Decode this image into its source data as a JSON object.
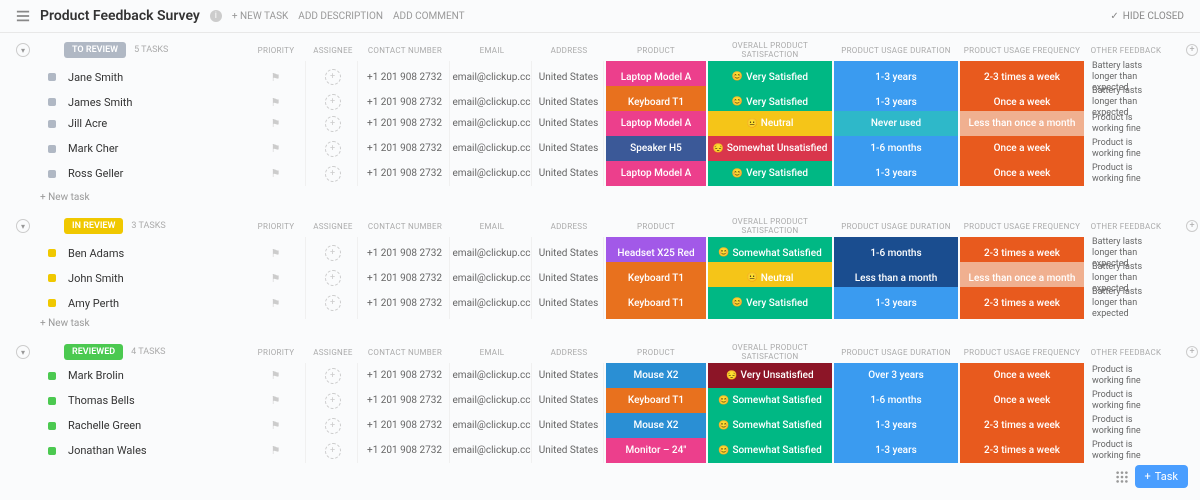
{
  "header": {
    "title": "Product Feedback Survey",
    "new_task": "+ NEW TASK",
    "add_desc": "ADD DESCRIPTION",
    "add_comment": "ADD COMMENT",
    "hide_closed": "HIDE CLOSED"
  },
  "columns": [
    "PRIORITY",
    "ASSIGNEE",
    "CONTACT NUMBER",
    "EMAIL",
    "ADDRESS",
    "PRODUCT",
    "OVERALL PRODUCT SATISFACTION",
    "PRODUCT USAGE DURATION",
    "PRODUCT USAGE FREQUENCY",
    "OTHER FEEDBACK"
  ],
  "new_task_label": "+ New task",
  "groups": [
    {
      "status": "TO REVIEW",
      "color": "#b0b8c4",
      "count": "5 TASKS",
      "rows": [
        {
          "name": "Jane Smith",
          "contact": "+1 201 908 2732",
          "email": "email@clickup.cc",
          "address": "United States",
          "product": {
            "t": "Laptop Model A",
            "c": "#ec3f8c"
          },
          "sat": {
            "t": "Very Satisfied",
            "e": "😊",
            "c": "#00b884"
          },
          "dur": {
            "t": "1-3 years",
            "c": "#3a9bf0"
          },
          "freq": {
            "t": "2-3 times a week",
            "c": "#e85a1e"
          },
          "fb": "Battery lasts longer than expected"
        },
        {
          "name": "James Smith",
          "contact": "+1 201 908 2732",
          "email": "email@clickup.cc",
          "address": "United States",
          "product": {
            "t": "Keyboard T1",
            "c": "#e8711e"
          },
          "sat": {
            "t": "Very Satisfied",
            "e": "😊",
            "c": "#00b884"
          },
          "dur": {
            "t": "1-3 years",
            "c": "#3a9bf0"
          },
          "freq": {
            "t": "Once a week",
            "c": "#e85a1e"
          },
          "fb": "Battery lasts longer than expected"
        },
        {
          "name": "Jill Acre",
          "contact": "+1 201 908 2732",
          "email": "email@clickup.cc",
          "address": "United States",
          "product": {
            "t": "Laptop Model A",
            "c": "#ec3f8c"
          },
          "sat": {
            "t": "Neutral",
            "e": "😐",
            "c": "#f5c518"
          },
          "dur": {
            "t": "Never used",
            "c": "#2eb8c9"
          },
          "freq": {
            "t": "Less than once a month",
            "c": "#f0b090"
          },
          "fb": "Product is working fine"
        },
        {
          "name": "Mark Cher",
          "contact": "+1 201 908 2732",
          "email": "email@clickup.cc",
          "address": "United States",
          "product": {
            "t": "Speaker H5",
            "c": "#3b5998"
          },
          "sat": {
            "t": "Somewhat Unsatisfied",
            "e": "😔",
            "c": "#d9364c"
          },
          "dur": {
            "t": "1-6 months",
            "c": "#3a9bf0"
          },
          "freq": {
            "t": "Once a week",
            "c": "#e85a1e"
          },
          "fb": "Product is working fine"
        },
        {
          "name": "Ross Geller",
          "contact": "+1 201 908 2732",
          "email": "email@clickup.cc",
          "address": "United States",
          "product": {
            "t": "Laptop Model A",
            "c": "#ec3f8c"
          },
          "sat": {
            "t": "Very Satisfied",
            "e": "😊",
            "c": "#00b884"
          },
          "dur": {
            "t": "1-3 years",
            "c": "#3a9bf0"
          },
          "freq": {
            "t": "Once a week",
            "c": "#e85a1e"
          },
          "fb": "Product is working fine"
        }
      ]
    },
    {
      "status": "IN REVIEW",
      "color": "#f0c800",
      "count": "3 TASKS",
      "rows": [
        {
          "name": "Ben Adams",
          "contact": "+1 201 908 2732",
          "email": "email@clickup.cc",
          "address": "United States",
          "product": {
            "t": "Headset X25 Red",
            "c": "#a259e8"
          },
          "sat": {
            "t": "Somewhat Satisfied",
            "e": "😊",
            "c": "#00b884"
          },
          "dur": {
            "t": "1-6 months",
            "c": "#1a4d8f"
          },
          "freq": {
            "t": "2-3 times a week",
            "c": "#e85a1e"
          },
          "fb": "Battery lasts longer than expected"
        },
        {
          "name": "John Smith",
          "contact": "+1 201 908 2732",
          "email": "email@clickup.cc",
          "address": "United States",
          "product": {
            "t": "Keyboard T1",
            "c": "#e8711e"
          },
          "sat": {
            "t": "Neutral",
            "e": "😐",
            "c": "#f5c518"
          },
          "dur": {
            "t": "Less than a month",
            "c": "#1a4d8f"
          },
          "freq": {
            "t": "Less than once a month",
            "c": "#f0b090"
          },
          "fb": "Battery lasts longer than expected"
        },
        {
          "name": "Amy Perth",
          "contact": "+1 201 908 2732",
          "email": "email@clickup.cc",
          "address": "United States",
          "product": {
            "t": "Keyboard T1",
            "c": "#e8711e"
          },
          "sat": {
            "t": "Very Satisfied",
            "e": "😊",
            "c": "#00b884"
          },
          "dur": {
            "t": "1-3 years",
            "c": "#3a9bf0"
          },
          "freq": {
            "t": "2-3 times a week",
            "c": "#e85a1e"
          },
          "fb": "Battery lasts longer than expected"
        }
      ]
    },
    {
      "status": "REVIEWED",
      "color": "#4bc950",
      "count": "4 TASKS",
      "rows": [
        {
          "name": "Mark Brolin",
          "contact": "+1 201 908 2732",
          "email": "email@clickup.cc",
          "address": "United States",
          "product": {
            "t": "Mouse X2",
            "c": "#2a8fd4"
          },
          "sat": {
            "t": "Very Unsatisfied",
            "e": "😔",
            "c": "#8c1527"
          },
          "dur": {
            "t": "Over 3 years",
            "c": "#3a9bf0"
          },
          "freq": {
            "t": "Once a week",
            "c": "#e85a1e"
          },
          "fb": "Product is working fine"
        },
        {
          "name": "Thomas Bells",
          "contact": "+1 201 908 2732",
          "email": "email@clickup.cc",
          "address": "United States",
          "product": {
            "t": "Keyboard T1",
            "c": "#e8711e"
          },
          "sat": {
            "t": "Somewhat Satisfied",
            "e": "😊",
            "c": "#00b884"
          },
          "dur": {
            "t": "1-6 months",
            "c": "#3a9bf0"
          },
          "freq": {
            "t": "Once a week",
            "c": "#e85a1e"
          },
          "fb": "Product is working fine"
        },
        {
          "name": "Rachelle Green",
          "contact": "+1 201 908 2732",
          "email": "email@clickup.cc",
          "address": "United States",
          "product": {
            "t": "Mouse X2",
            "c": "#2a8fd4"
          },
          "sat": {
            "t": "Somewhat Satisfied",
            "e": "😊",
            "c": "#00b884"
          },
          "dur": {
            "t": "1-3 years",
            "c": "#3a9bf0"
          },
          "freq": {
            "t": "2-3 times a week",
            "c": "#e85a1e"
          },
          "fb": "Product is working fine"
        },
        {
          "name": "Jonathan Wales",
          "contact": "+1 201 908 2732",
          "email": "email@clickup.cc",
          "address": "United States",
          "product": {
            "t": "Monitor – 24\"",
            "c": "#ec3f8c"
          },
          "sat": {
            "t": "Somewhat Satisfied",
            "e": "😊",
            "c": "#00b884"
          },
          "dur": {
            "t": "1-3 years",
            "c": "#3a9bf0"
          },
          "freq": {
            "t": "2-3 times a week",
            "c": "#e85a1e"
          },
          "fb": "Product is working fine"
        }
      ]
    }
  ],
  "fab": {
    "label": "Task"
  }
}
